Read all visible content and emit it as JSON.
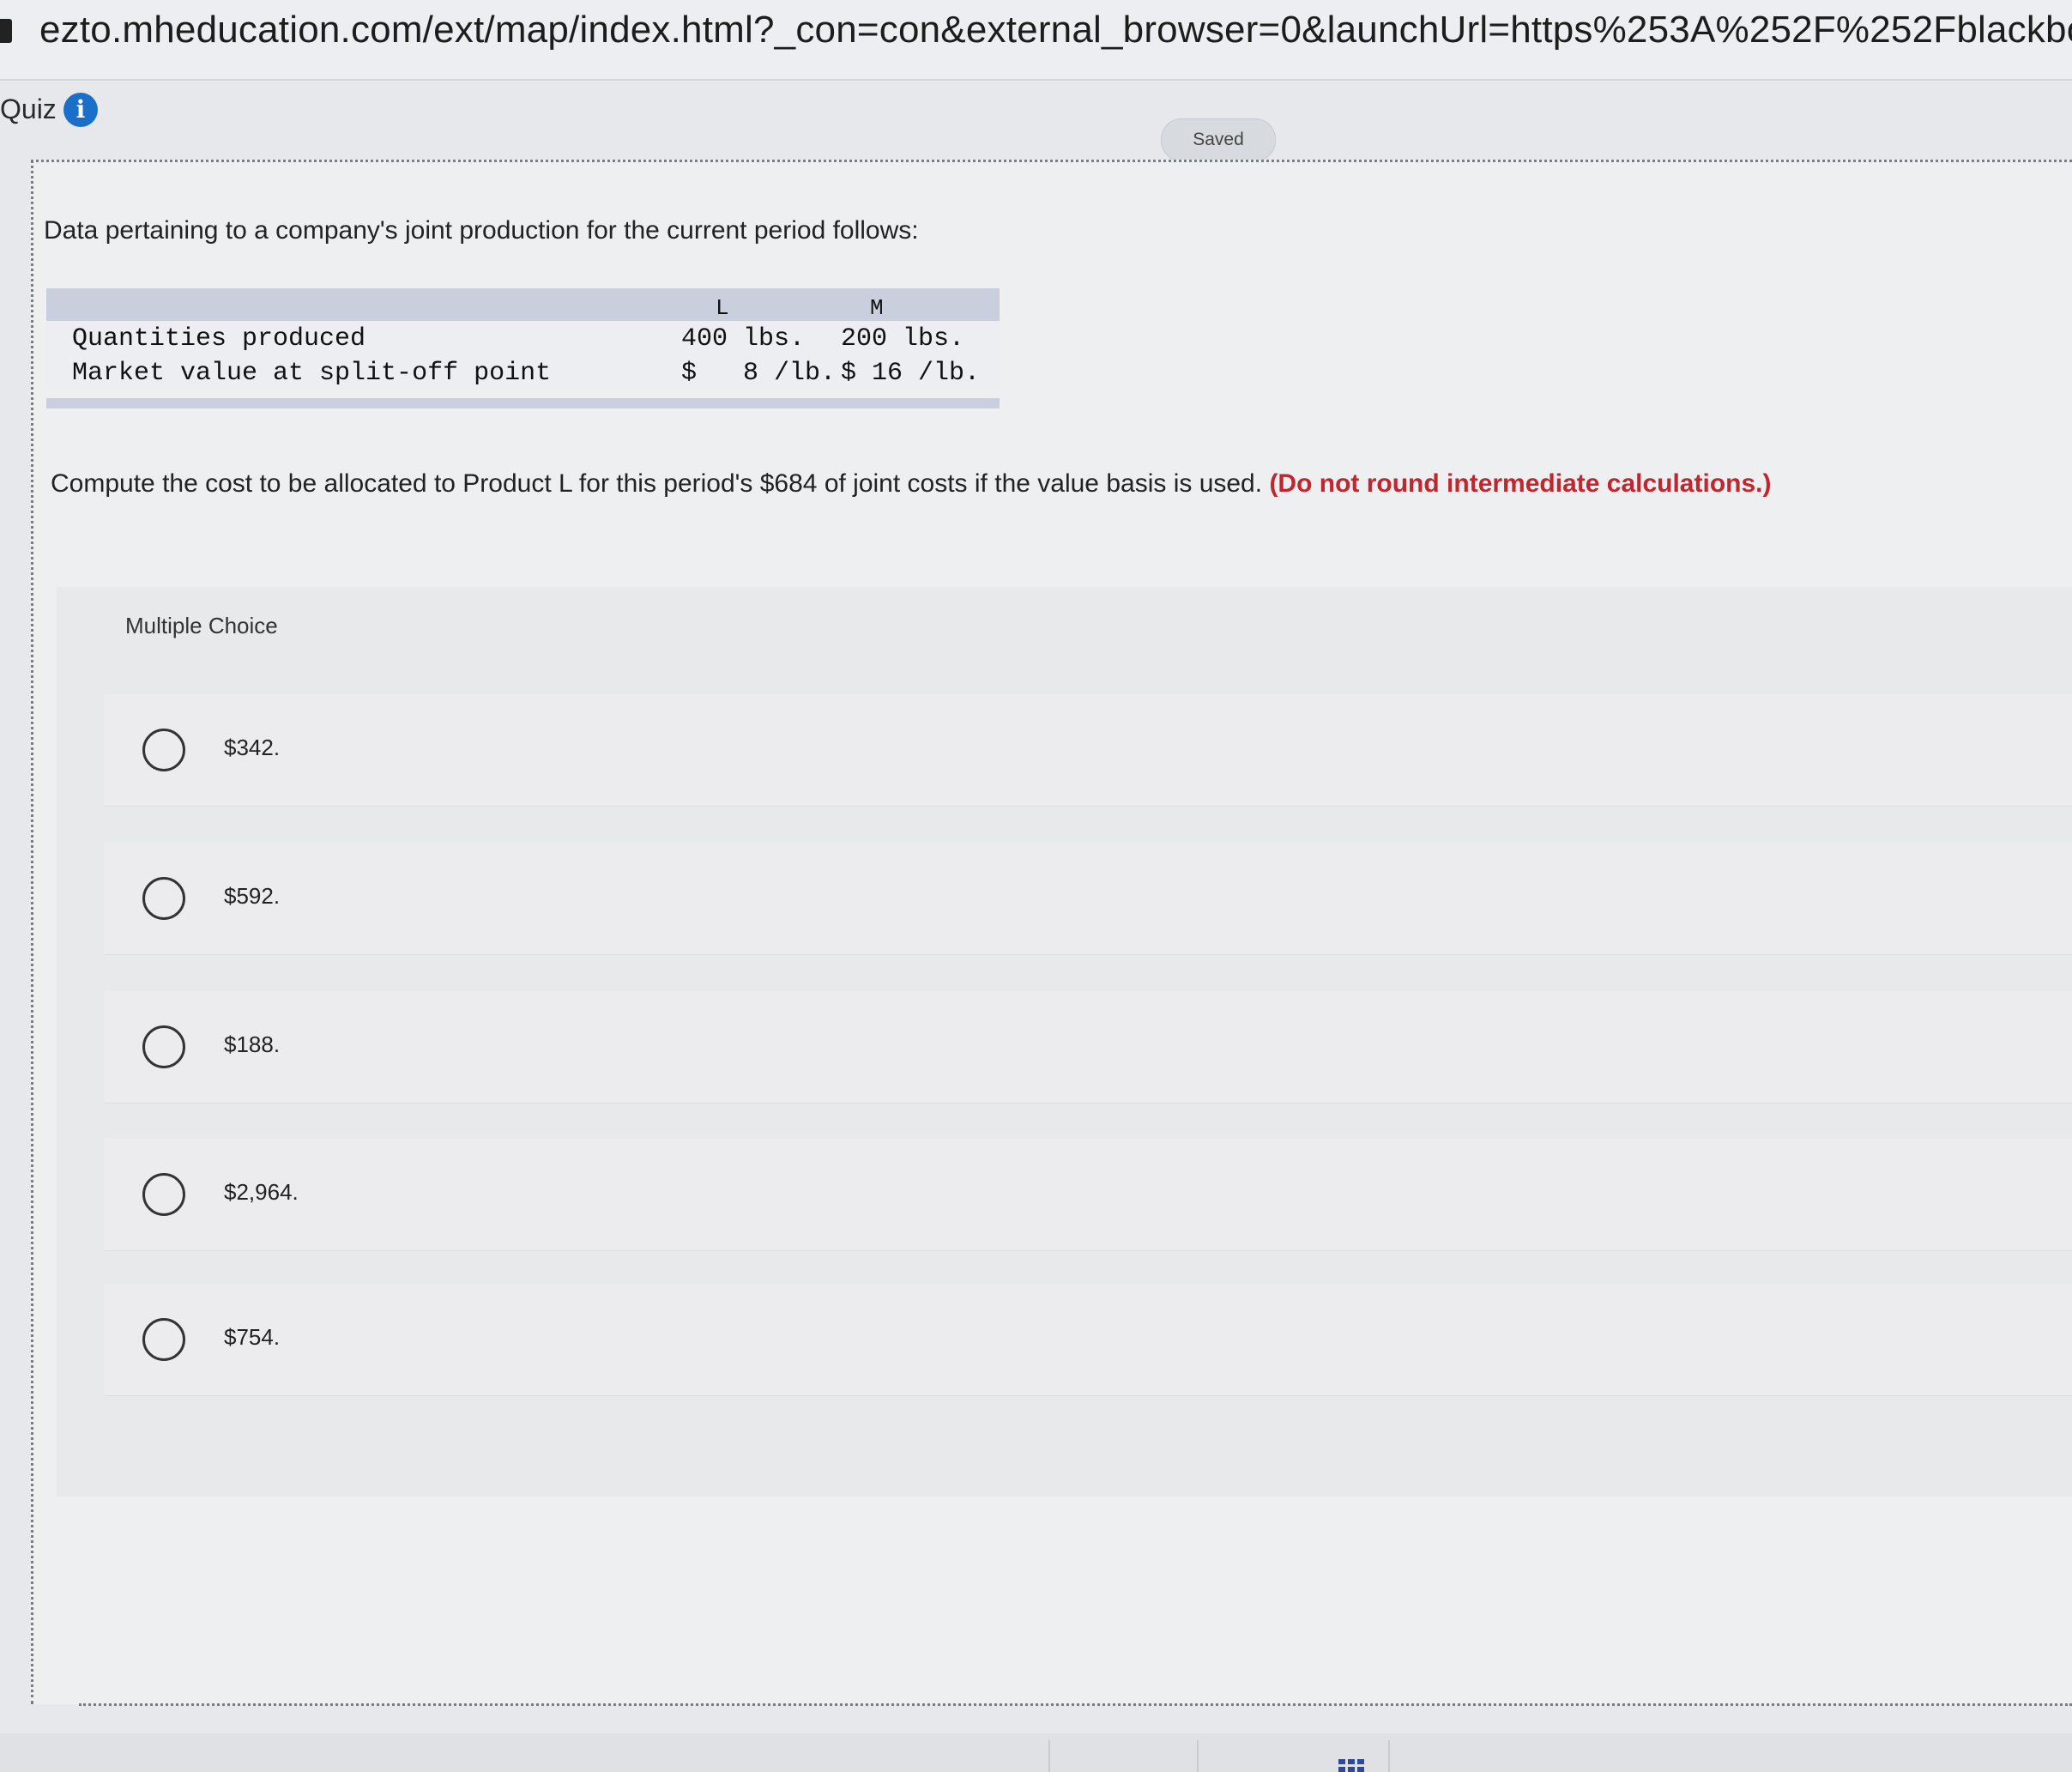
{
  "browser": {
    "url": "ezto.mheducation.com/ext/map/index.html?_con=con&external_browser=0&launchUrl=https%253A%252F%252Fblackboard."
  },
  "header": {
    "quiz_label": "Quiz",
    "info_glyph": "i",
    "saved_label": "Saved"
  },
  "question": {
    "intro": "Data pertaining to a company's joint production for the current period follows:",
    "table": {
      "col_l": "L",
      "col_m": "M",
      "rows": [
        {
          "label": "Quantities produced",
          "l": "400 lbs.",
          "m": "200 lbs."
        },
        {
          "label": "Market value at split-off point",
          "l": "$   8 /lb.",
          "m": "$ 16 /lb."
        }
      ]
    },
    "prompt": "Compute the cost to be allocated to Product L for this period's $684 of joint costs if the value basis is used.",
    "note": "(Do not round intermediate calculations.)"
  },
  "multiple_choice": {
    "title": "Multiple Choice",
    "options": [
      "$342.",
      "$592.",
      "$188.",
      "$2,964.",
      "$754."
    ]
  },
  "colors": {
    "accent_blue": "#1a6fc9",
    "note_red": "#c0262d"
  },
  "icons": [
    "lock-icon",
    "info-icon",
    "radio-icon",
    "grid-icon"
  ]
}
